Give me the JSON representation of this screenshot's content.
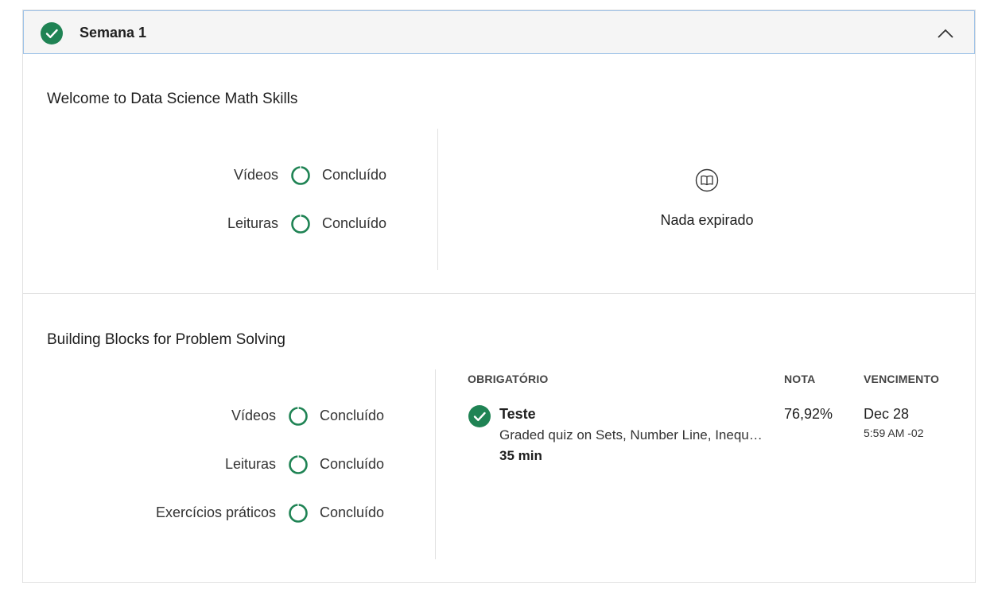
{
  "week": {
    "title": "Semana 1"
  },
  "sections": [
    {
      "title": "Welcome to Data Science Math Skills",
      "stats": [
        {
          "label": "Vídeos",
          "status": "Concluído"
        },
        {
          "label": "Leituras",
          "status": "Concluído"
        }
      ],
      "right_panel": {
        "icon": "book-icon",
        "text": "Nada expirado"
      }
    },
    {
      "title": "Building Blocks for Problem Solving",
      "stats": [
        {
          "label": "Vídeos",
          "status": "Concluído"
        },
        {
          "label": "Leituras",
          "status": "Concluído"
        },
        {
          "label": "Exercícios práticos",
          "status": "Concluído"
        }
      ],
      "table": {
        "headers": {
          "required": "OBRIGATÓRIO",
          "grade": "NOTA",
          "due": "VENCIMENTO"
        },
        "items": [
          {
            "title": "Teste",
            "description": "Graded quiz on Sets, Number Line, Inequalities, Simplification, and Sigma Notation",
            "duration": "35 min",
            "grade": "76,92%",
            "due_date": "Dec 28",
            "due_time": "5:59 AM -02"
          }
        ]
      }
    }
  ],
  "colors": {
    "accent_green": "#1f8354",
    "header_border": "#9fc3e8",
    "divider": "#e1e1e1"
  }
}
